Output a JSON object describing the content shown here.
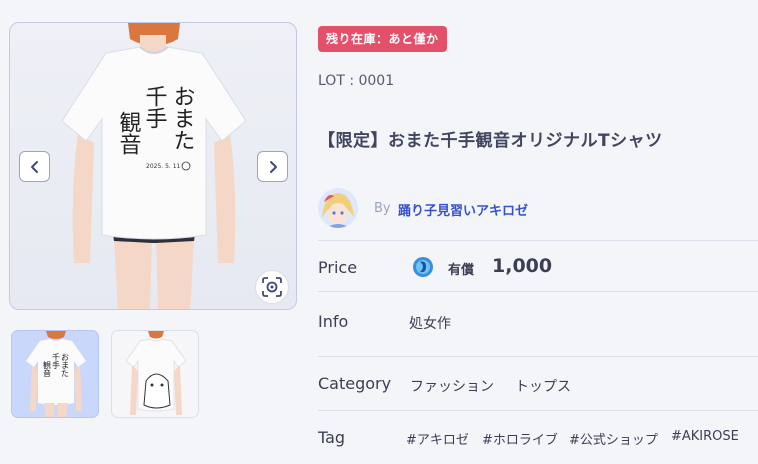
{
  "product": {
    "stock_badge": "残り在庫：あと僅か",
    "lot": "LOT : 0001",
    "title": "【限定】おまた千手観音オリジナルTシャツ"
  },
  "shirt_print": {
    "line1": "おまた",
    "line2": "千手",
    "line3": "観音",
    "date": "2025. 5. 11"
  },
  "creator": {
    "by_label": "By",
    "name": "踊り子見習いアキロゼ"
  },
  "details": {
    "price_label": "Price",
    "price_type": "有償",
    "price_value": "1,000",
    "info_label": "Info",
    "info_value": "処女作",
    "category_label": "Category",
    "categories": [
      "ファッション",
      "トップス"
    ],
    "tag_label": "Tag",
    "tags": [
      "#アキロゼ",
      "#ホロライブ",
      "#公式ショップ",
      "#AKIROSE"
    ]
  },
  "icons": {
    "prev": "chevron-left-icon",
    "next": "chevron-right-icon",
    "ar_view": "ar-view-icon",
    "coin": "coin-icon"
  },
  "colors": {
    "badge_bg": "#e2506a",
    "accent": "#3552c8",
    "thumb_selected": "#c9d7fb"
  }
}
